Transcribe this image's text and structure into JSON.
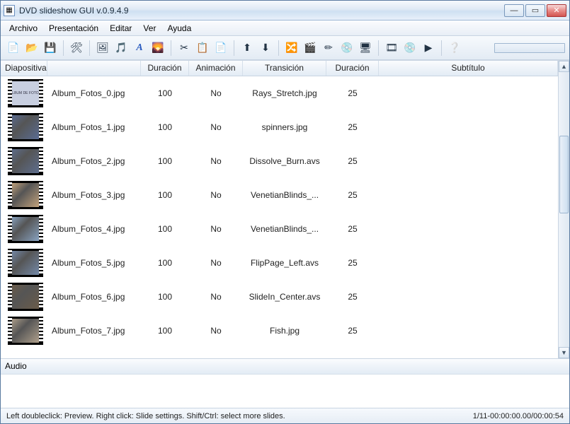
{
  "window": {
    "title": "DVD slideshow GUI v.0.9.4.9"
  },
  "menu": {
    "items": [
      "Archivo",
      "Presentación",
      "Editar",
      "Ver",
      "Ayuda"
    ]
  },
  "toolbar": {
    "groups": [
      [
        {
          "name": "new",
          "icon": "📄"
        },
        {
          "name": "open",
          "icon": "📂"
        },
        {
          "name": "save",
          "icon": "💾"
        }
      ],
      [
        {
          "name": "settings",
          "icon": "🛠"
        }
      ],
      [
        {
          "name": "add-images",
          "icon": "🖼"
        },
        {
          "name": "add-audio",
          "icon": "🎵"
        },
        {
          "name": "font",
          "icon": "A"
        },
        {
          "name": "background",
          "icon": "🌄"
        }
      ],
      [
        {
          "name": "cut",
          "icon": "✂"
        },
        {
          "name": "copy",
          "icon": "📋"
        },
        {
          "name": "paste",
          "icon": "📄"
        }
      ],
      [
        {
          "name": "move-up",
          "icon": "⬆"
        },
        {
          "name": "move-down",
          "icon": "⬇"
        }
      ],
      [
        {
          "name": "transition",
          "icon": "🔀"
        },
        {
          "name": "animate",
          "icon": "🎬"
        },
        {
          "name": "subtitle",
          "icon": "✏"
        },
        {
          "name": "dvd-menu",
          "icon": "💿"
        },
        {
          "name": "preview",
          "icon": "🖥"
        }
      ],
      [
        {
          "name": "export-video",
          "icon": "🎞"
        },
        {
          "name": "burn-dvd",
          "icon": "💿"
        },
        {
          "name": "export-youtube",
          "icon": "▶"
        }
      ],
      [
        {
          "name": "help",
          "icon": "❔"
        }
      ]
    ]
  },
  "columns": {
    "slide": "Diapositiva",
    "duration1": "Duración",
    "animation": "Animación",
    "transition": "Transición",
    "duration2": "Duración",
    "subtitle": "Subtítulo"
  },
  "slides": [
    {
      "file": "Album_Fotos_0.jpg",
      "duration": "100",
      "animation": "No",
      "transition": "Rays_Stretch.jpg",
      "trans_dur": "25",
      "sub": "",
      "color": "#c8cfe0",
      "text": "ALBUM DE FOTOS",
      "textmode": true
    },
    {
      "file": "Album_Fotos_1.jpg",
      "duration": "100",
      "animation": "No",
      "transition": "spinners.jpg",
      "trans_dur": "25",
      "sub": "",
      "color": "#5a6d96"
    },
    {
      "file": "Album_Fotos_2.jpg",
      "duration": "100",
      "animation": "No",
      "transition": "Dissolve_Burn.avs",
      "trans_dur": "25",
      "sub": "",
      "color": "#5e6f91"
    },
    {
      "file": "Album_Fotos_3.jpg",
      "duration": "100",
      "animation": "No",
      "transition": "VenetianBlinds_...",
      "trans_dur": "25",
      "sub": "",
      "color": "#c9a77e"
    },
    {
      "file": "Album_Fotos_4.jpg",
      "duration": "100",
      "animation": "No",
      "transition": "VenetianBlinds_...",
      "trans_dur": "25",
      "sub": "",
      "color": "#8ba7c7"
    },
    {
      "file": "Album_Fotos_5.jpg",
      "duration": "100",
      "animation": "No",
      "transition": "FlipPage_Left.avs",
      "trans_dur": "25",
      "sub": "",
      "color": "#768dae"
    },
    {
      "file": "Album_Fotos_6.jpg",
      "duration": "100",
      "animation": "No",
      "transition": "SlideIn_Center.avs",
      "trans_dur": "25",
      "sub": "",
      "color": "#6b5c49"
    },
    {
      "file": "Album_Fotos_7.jpg",
      "duration": "100",
      "animation": "No",
      "transition": "Fish.jpg",
      "trans_dur": "25",
      "sub": "",
      "color": "#b4a48f"
    }
  ],
  "audio": {
    "header": "Audio"
  },
  "status": {
    "left": "Left doubleclick: Preview. Right click: Slide settings. Shift/Ctrl: select more slides.",
    "right": "1/11-00:00:00.00/00:00:54"
  }
}
